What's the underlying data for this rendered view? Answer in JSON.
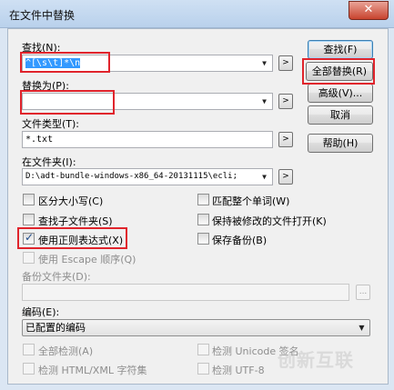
{
  "window": {
    "title": "在文件中替换",
    "close_glyph": "✕"
  },
  "find": {
    "label": "查找(N):",
    "value": "^[\\s\\t]*\\n"
  },
  "replace": {
    "label": "替换为(P):",
    "value": ""
  },
  "filetype": {
    "label": "文件类型(T):",
    "value": "*.txt"
  },
  "folder": {
    "label": "在文件夹(I):",
    "value": "D:\\adt-bundle-windows-x86_64-20131115\\ecli;"
  },
  "arrow_button": ">",
  "buttons": {
    "find": "查找(F)",
    "replace_all": "全部替换(R)",
    "advanced": "高级(V)...",
    "cancel": "取消",
    "help": "帮助(H)"
  },
  "options": {
    "match_case": "区分大小写(C)",
    "whole_word": "匹配整个单词(W)",
    "subfolders": "查找子文件夹(S)",
    "keep_open": "保持被修改的文件打开(K)",
    "regex": "使用正则表达式(X)",
    "backup": "保存备份(B)",
    "escape": "使用 Escape 顺序(Q)"
  },
  "checked": {
    "regex": true
  },
  "backup_folder": {
    "label": "备份文件夹(D):",
    "browse": "..."
  },
  "encoding": {
    "label": "编码(E):",
    "value": "已配置的编码",
    "detect_all": "全部检测(A)",
    "detect_unicode": "检测 Unicode 签名",
    "detect_html": "检测 HTML/XML 字符集",
    "detect_utf8": "检测 UTF-8"
  },
  "watermark": "创新互联"
}
